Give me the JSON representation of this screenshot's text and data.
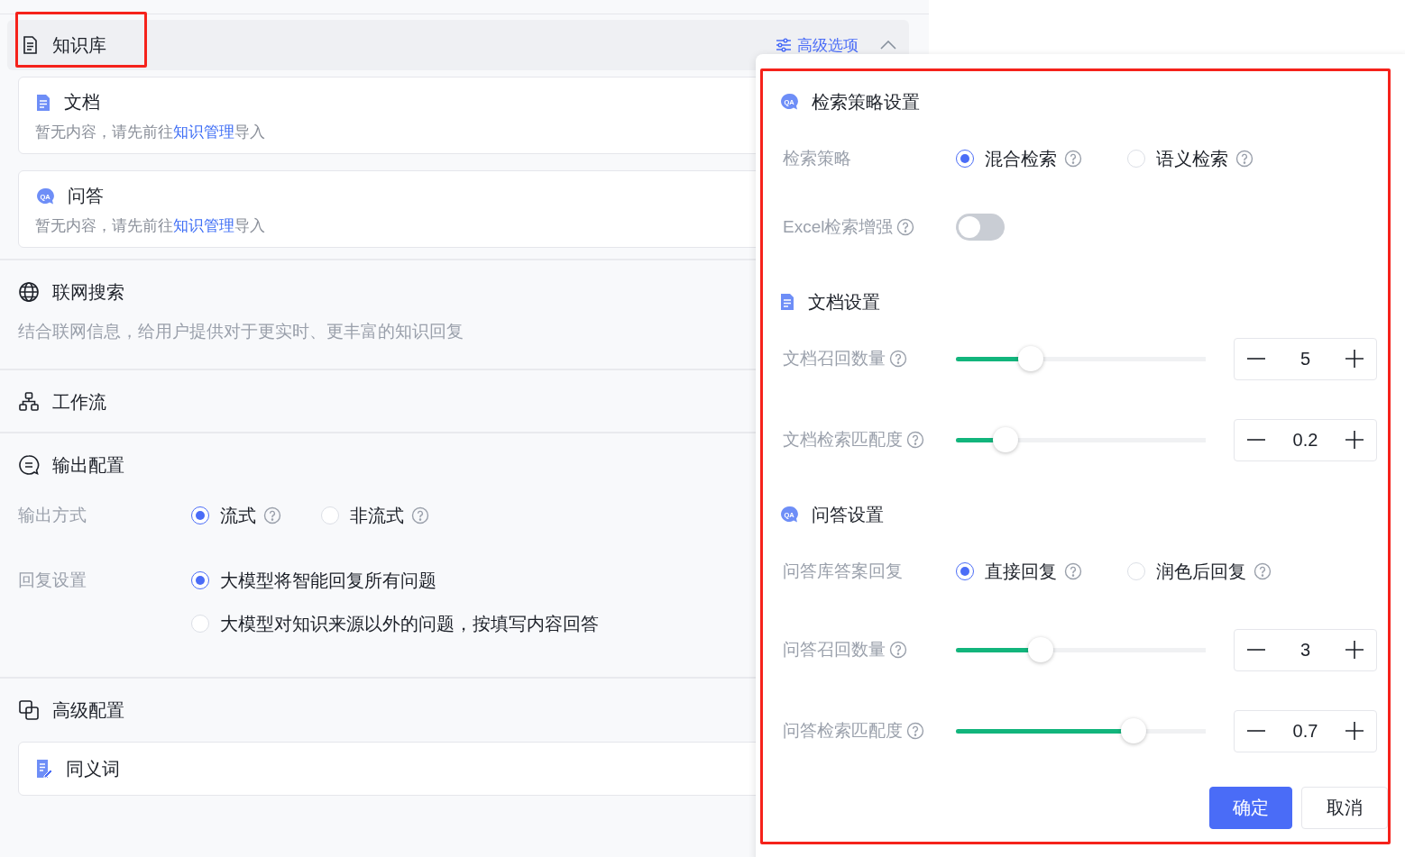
{
  "knowledge_base": {
    "title": "知识库",
    "annotated": true,
    "advanced_link": "高级选项",
    "expanded": true,
    "sources": [
      {
        "kind": "doc",
        "title": "文档",
        "hint": "暂无内容，请先前往",
        "link": "知识管理",
        "hint_end": "导入"
      },
      {
        "kind": "qa",
        "icon_text": "QA",
        "title": "问答",
        "hint": "暂无内容，请先前往",
        "link": "知识管理",
        "hint_end": "导入"
      }
    ]
  },
  "web_search": {
    "title": "联网搜索",
    "description": "结合联网信息，给用户提供对于更实时、更丰富的知识回复"
  },
  "workflow": {
    "title": "工作流"
  },
  "output_config": {
    "title": "输出配置",
    "rows": [
      {
        "label": "输出方式",
        "kind": "inline",
        "options": [
          {
            "label": "流式",
            "help": true,
            "selected": true
          },
          {
            "label": "非流式",
            "help": true,
            "selected": false
          }
        ]
      },
      {
        "label": "回复设置",
        "kind": "stacked",
        "options": [
          {
            "label": "大模型将智能回复所有问题",
            "help": false,
            "selected": true
          },
          {
            "label": "大模型对知识来源以外的问题，按填写内容回答",
            "help": false,
            "selected": false
          }
        ]
      }
    ]
  },
  "advanced_config": {
    "title": "高级配置",
    "items": [
      {
        "kind": "synonym",
        "label": "同义词"
      }
    ]
  },
  "popover": {
    "annotated": true,
    "sections": [
      {
        "kind": "qa",
        "icon_text": "QA",
        "title": "检索策略设置",
        "rows": [
          {
            "kind": "radio",
            "label": "检索策略",
            "help": false,
            "options": [
              {
                "label": "混合检索",
                "help": true,
                "selected": true
              },
              {
                "label": "语义检索",
                "help": true,
                "selected": false
              }
            ]
          },
          {
            "kind": "switch",
            "label": "Excel检索增强",
            "help": true,
            "on": false
          }
        ]
      },
      {
        "kind": "doc",
        "title": "文档设置",
        "rows": [
          {
            "kind": "slider",
            "label": "文档召回数量",
            "help": true,
            "level": 0.3,
            "value": "5"
          },
          {
            "kind": "slider",
            "label": "文档检索匹配度",
            "help": true,
            "level": 0.2,
            "value": "0.2"
          }
        ]
      },
      {
        "kind": "qa",
        "icon_text": "QA",
        "title": "问答设置",
        "rows": [
          {
            "kind": "radio",
            "label": "问答库答案回复",
            "help": false,
            "options": [
              {
                "label": "直接回复",
                "help": true,
                "selected": true
              },
              {
                "label": "润色后回复",
                "help": true,
                "selected": false
              }
            ]
          },
          {
            "kind": "slider",
            "label": "问答召回数量",
            "help": true,
            "level": 0.34,
            "value": "3"
          },
          {
            "kind": "slider",
            "label": "问答检索匹配度",
            "help": true,
            "level": 0.71,
            "value": "0.7"
          }
        ]
      }
    ],
    "buttons": [
      {
        "kind": "primary",
        "label": "确定"
      },
      {
        "kind": "default",
        "label": "取消"
      }
    ]
  }
}
